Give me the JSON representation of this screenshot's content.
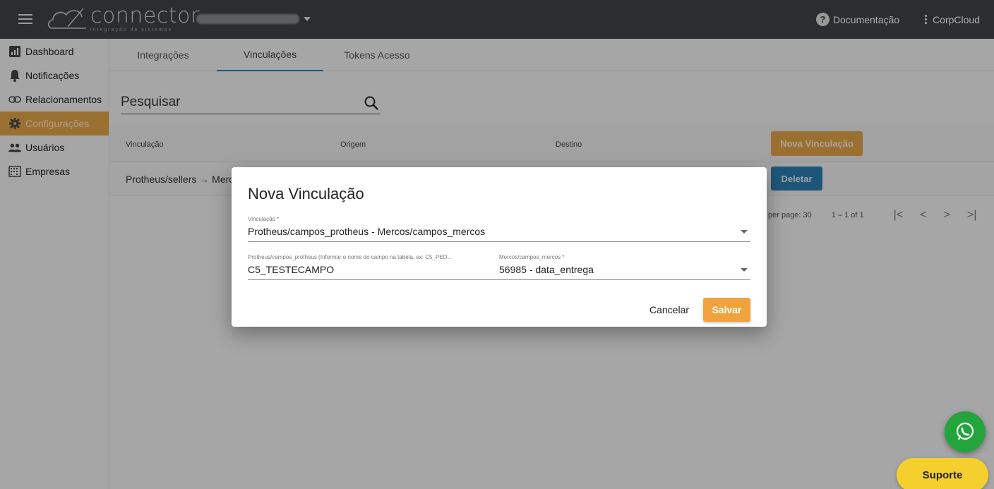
{
  "topbar": {
    "logo_text": "connector",
    "logo_subtitle": "integração de sistemas",
    "documentation_label": "Documentação",
    "account_label": "CorpCloud"
  },
  "sidebar": {
    "items": [
      {
        "label": "Dashboard",
        "icon": "chart-icon"
      },
      {
        "label": "Notificações",
        "icon": "bell-icon"
      },
      {
        "label": "Relacionamentos",
        "icon": "link-icon"
      },
      {
        "label": "Configurações",
        "icon": "gear-icon",
        "active": true
      },
      {
        "label": "Usuários",
        "icon": "users-icon"
      },
      {
        "label": "Empresas",
        "icon": "building-icon"
      }
    ]
  },
  "main": {
    "tabs": [
      {
        "label": "Integrações"
      },
      {
        "label": "Vinculações",
        "active": true
      },
      {
        "label": "Tokens Acesso"
      }
    ],
    "search_placeholder": "Pesquisar",
    "table": {
      "headers": [
        "Vinculação",
        "Origem",
        "Destino"
      ],
      "new_button": "Nova Vinculação",
      "rows": [
        {
          "vinculacao_start": "Protheus/sellers",
          "vinculacao_end": "Merc",
          "delete_label": "Deletar"
        }
      ]
    },
    "paginator": {
      "per_page_text": "per page: 30",
      "range_text": "1 – 1 of 1"
    }
  },
  "dialog": {
    "title": "Nova Vinculação",
    "vinculacao_label": "Vinculação *",
    "vinculacao_value": "Protheus/campos_protheus - Mercos/campos_mercos",
    "origin_label": "Protheus/campos_protheus (Informar o nome do campo na tabela, ex: C5_PED...",
    "origin_value": "C5_TESTECAMPO",
    "dest_label": "Mercos/campos_mercos *",
    "dest_value": "56985 - data_entrega",
    "cancel_label": "Cancelar",
    "save_label": "Salvar"
  },
  "floating": {
    "support_label": "Suporte"
  },
  "colors": {
    "topbar": "#3f4447",
    "accent_orange": "#e3a64a",
    "accent_blue": "#2d7fb3",
    "whatsapp": "#23a43c",
    "support": "#f4cf2e"
  }
}
